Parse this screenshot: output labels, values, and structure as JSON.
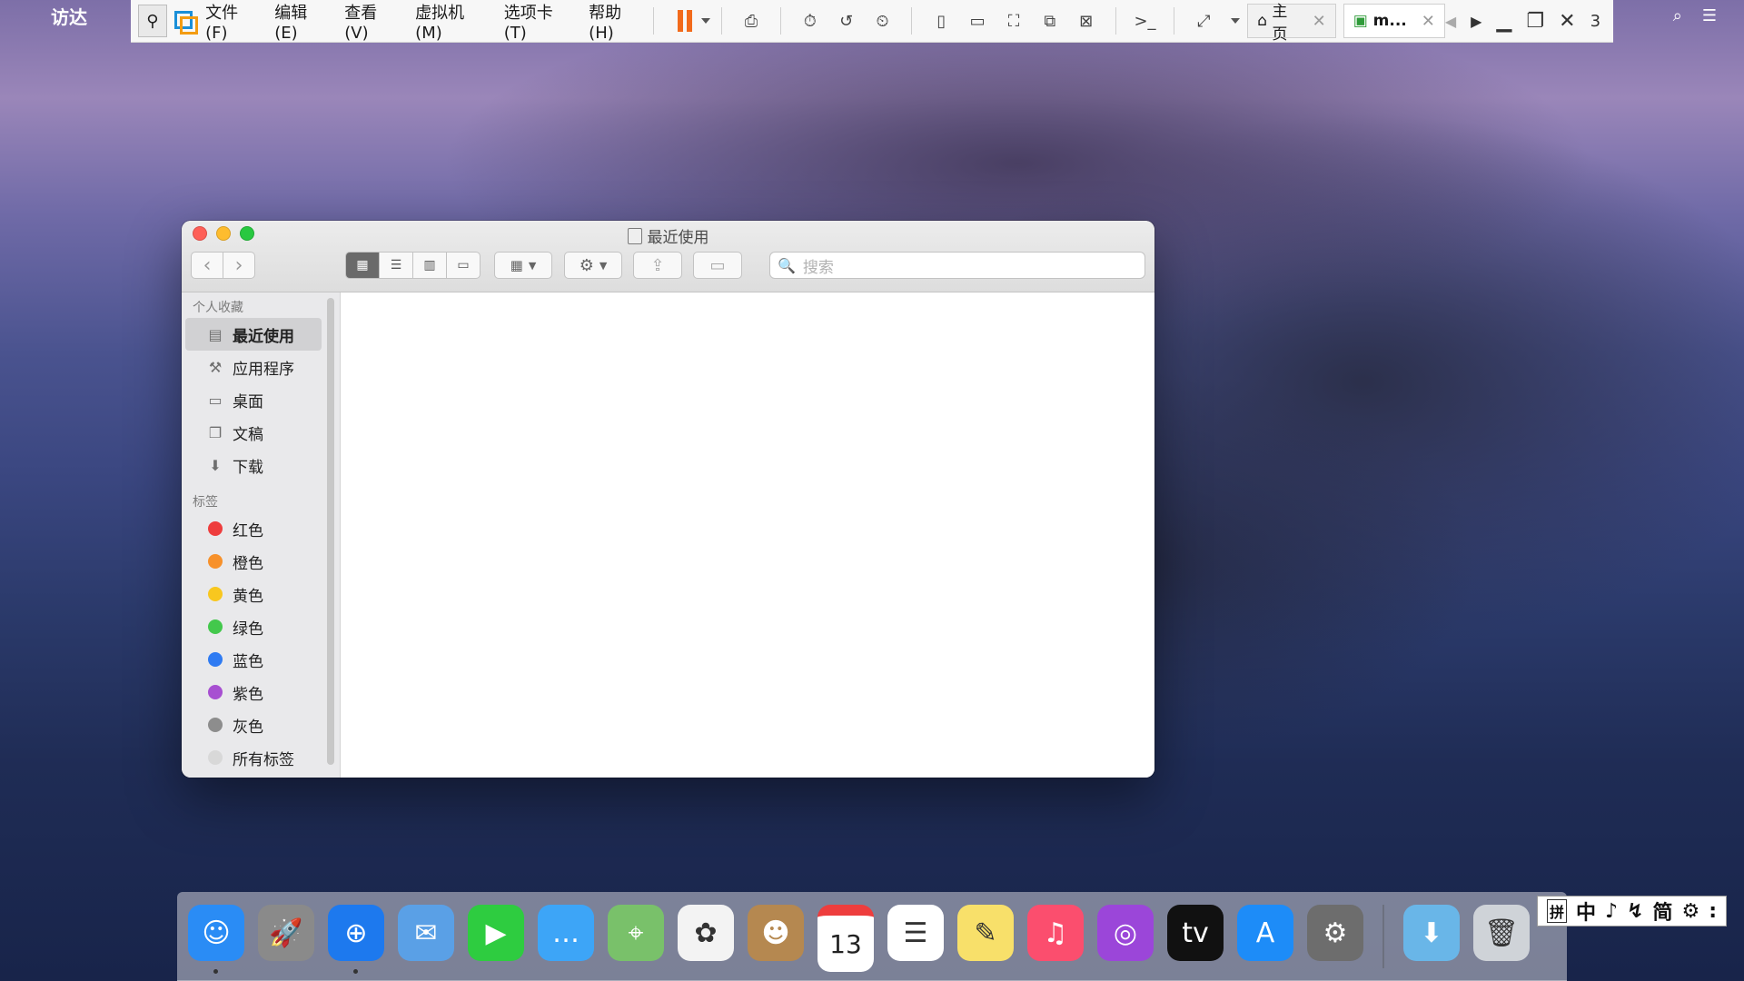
{
  "menubar": {
    "apple": "",
    "app": "访达"
  },
  "vmware": {
    "menus": [
      "文件(F)",
      "编辑(E)",
      "查看(V)",
      "虚拟机(M)",
      "选项卡(T)",
      "帮助(H)"
    ],
    "tabs": [
      {
        "label": "主页",
        "close": "✕"
      },
      {
        "label": "m...",
        "close": "✕"
      }
    ],
    "counter": "3"
  },
  "finder": {
    "title": "最近使用",
    "search_placeholder": "搜索",
    "sidebar": {
      "favorites_heading": "个人收藏",
      "favorites": [
        {
          "label": "最近使用",
          "icon": "recents-icon"
        },
        {
          "label": "应用程序",
          "icon": "applications-icon"
        },
        {
          "label": "桌面",
          "icon": "desktop-icon"
        },
        {
          "label": "文稿",
          "icon": "documents-icon"
        },
        {
          "label": "下载",
          "icon": "downloads-icon"
        }
      ],
      "tags_heading": "标签",
      "tags": [
        {
          "label": "红色",
          "color": "#ee3d3d"
        },
        {
          "label": "橙色",
          "color": "#f7912b"
        },
        {
          "label": "黄色",
          "color": "#f8c71f"
        },
        {
          "label": "绿色",
          "color": "#43c84c"
        },
        {
          "label": "蓝色",
          "color": "#2f7bf2"
        },
        {
          "label": "紫色",
          "color": "#a74fd1"
        },
        {
          "label": "灰色",
          "color": "#8d8d8d"
        },
        {
          "label": "所有标签",
          "color": "#d8d8d8"
        }
      ]
    }
  },
  "dock": {
    "apps": [
      {
        "name": "finder",
        "bg": "#2a8cf5",
        "glyph": "☺",
        "running": true
      },
      {
        "name": "launchpad",
        "bg": "#8a8a8a",
        "glyph": "🚀",
        "running": false
      },
      {
        "name": "safari",
        "bg": "#1d79ee",
        "glyph": "⊕",
        "running": true
      },
      {
        "name": "mail",
        "bg": "#5aa0e6",
        "glyph": "✉",
        "running": false
      },
      {
        "name": "facetime",
        "bg": "#2ecc40",
        "glyph": "▶",
        "running": false
      },
      {
        "name": "messages",
        "bg": "#3da5f7",
        "glyph": "…",
        "running": false
      },
      {
        "name": "maps",
        "bg": "#79c16a",
        "glyph": "⌖",
        "running": false
      },
      {
        "name": "photos",
        "bg": "#f3f3f3",
        "glyph": "✿",
        "running": false
      },
      {
        "name": "contacts",
        "bg": "#b58850",
        "glyph": "☻",
        "running": false
      },
      {
        "name": "calendar",
        "bg": "#ffffff",
        "glyph": "13",
        "running": false
      },
      {
        "name": "reminders",
        "bg": "#ffffff",
        "glyph": "☰",
        "running": false
      },
      {
        "name": "notes",
        "bg": "#f8e06a",
        "glyph": "✎",
        "running": false
      },
      {
        "name": "music",
        "bg": "#fb4e6e",
        "glyph": "♫",
        "running": false
      },
      {
        "name": "podcasts",
        "bg": "#9b46d9",
        "glyph": "◎",
        "running": false
      },
      {
        "name": "tv",
        "bg": "#111111",
        "glyph": "tv",
        "running": false
      },
      {
        "name": "app-store",
        "bg": "#1d8cf8",
        "glyph": "A",
        "running": false
      },
      {
        "name": "system-preferences",
        "bg": "#6d6d6d",
        "glyph": "⚙",
        "running": false
      }
    ],
    "downloads": {
      "name": "downloads-folder",
      "bg": "#69b6e8",
      "glyph": "⬇"
    },
    "trash": {
      "name": "trash",
      "bg": "#cfd3d8",
      "glyph": "🗑"
    }
  },
  "ime": {
    "items": [
      "拼",
      "中",
      "♪",
      "↯",
      "简",
      "⚙",
      ":"
    ]
  }
}
